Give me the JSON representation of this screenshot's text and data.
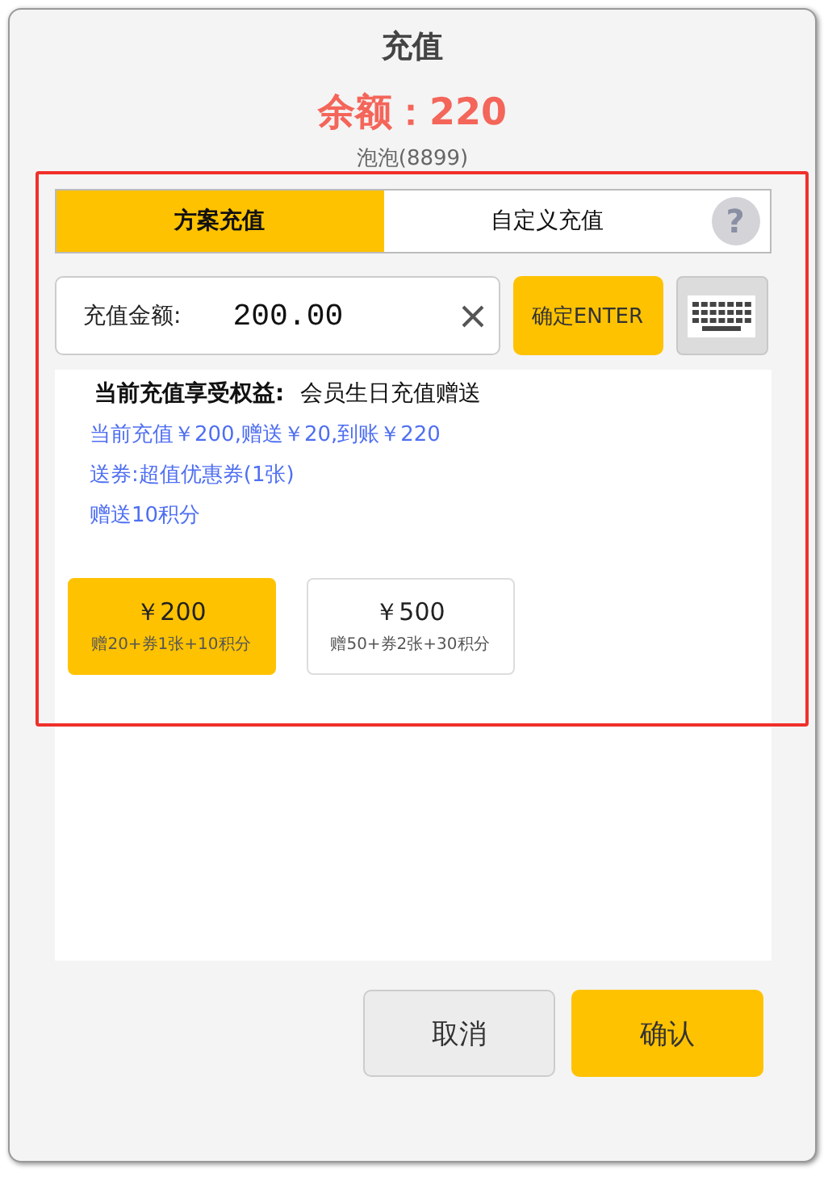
{
  "dialog": {
    "title": "充值",
    "balance": "余额：220",
    "member": "泡泡(8899)"
  },
  "tabs": [
    {
      "label": "方案充值",
      "selected": true
    },
    {
      "label": "自定义充值",
      "selected": false
    }
  ],
  "help": "?",
  "amount_field": {
    "label": "充值金额:",
    "value": "200.00"
  },
  "enter_button": "确定ENTER",
  "benefits": {
    "heading": "当前充值享受权益:",
    "title": "会员生日充值赠送",
    "lines": [
      "当前充值￥200,赠送￥20,到账￥220",
      "送券:超值优惠券(1张)",
      "赠送10积分"
    ]
  },
  "plans": [
    {
      "price": "￥200",
      "detail": "赠20+券1张+10积分",
      "selected": true
    },
    {
      "price": "￥500",
      "detail": "赠50+券2张+30积分",
      "selected": false
    }
  ],
  "buttons": [
    {
      "label": "取消",
      "kind": "cancel"
    },
    {
      "label": "确认",
      "kind": "confirm"
    }
  ]
}
